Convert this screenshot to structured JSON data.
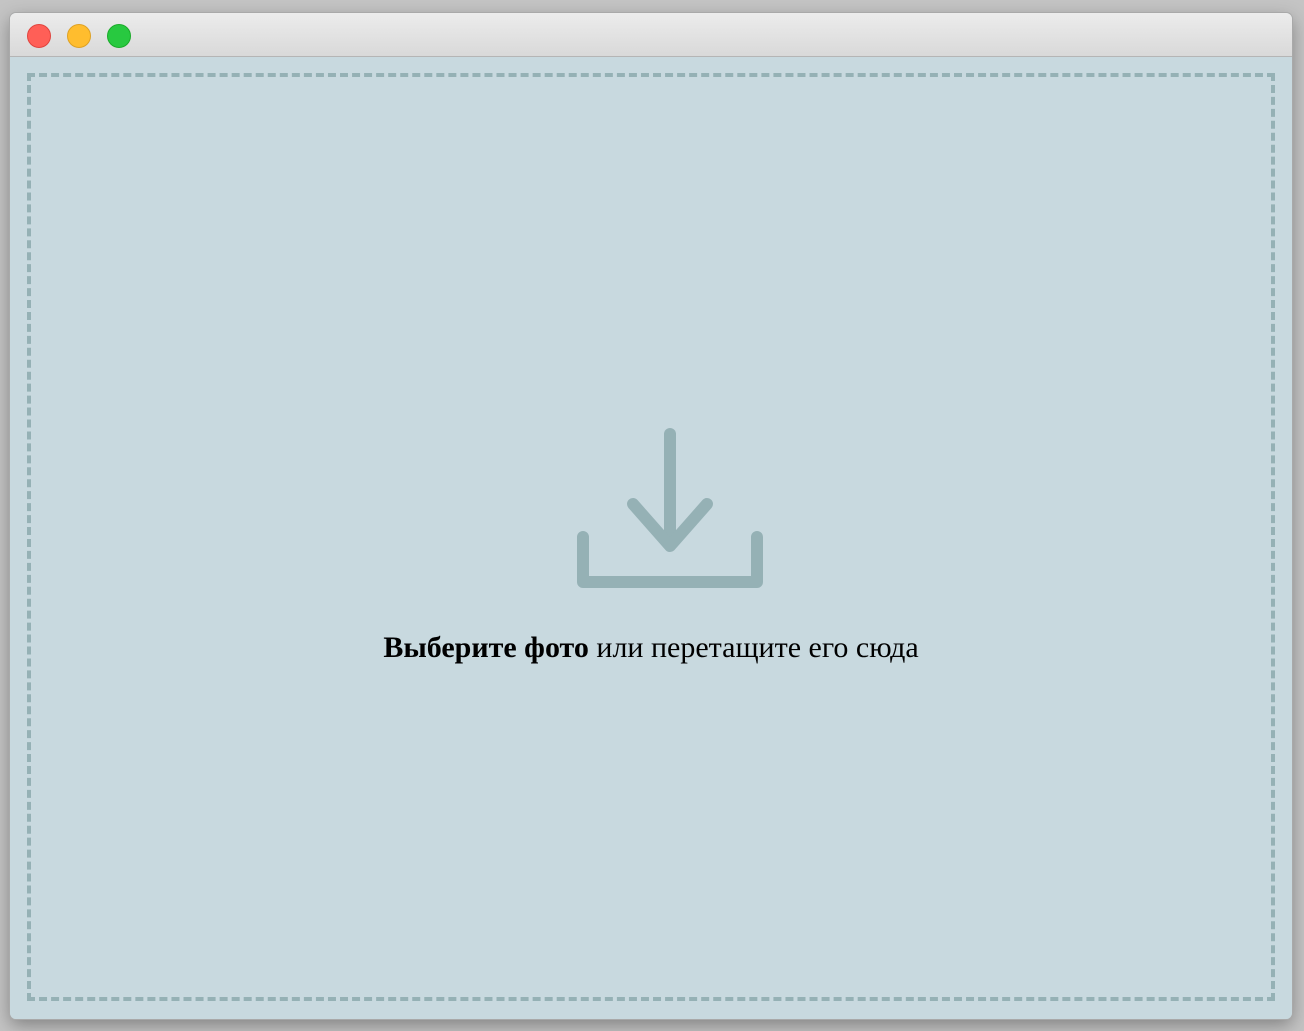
{
  "window": {
    "controls": [
      {
        "name": "close",
        "color": "#ff5f57",
        "border": "#e0443e"
      },
      {
        "name": "minimize",
        "color": "#ffbd2e",
        "border": "#dea123"
      },
      {
        "name": "zoom",
        "color": "#28c940",
        "border": "#1aab29"
      }
    ]
  },
  "dropzone": {
    "icon": "download-icon",
    "icon_color": "#95b1b5",
    "border_color": "#95b1b5",
    "background_color": "#c8d9df",
    "prompt_link": "Выберите фото",
    "prompt_rest": " или перетащите его сюда"
  }
}
